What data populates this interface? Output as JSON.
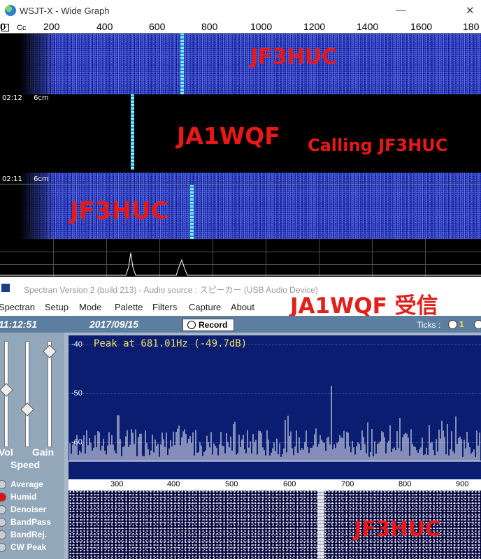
{
  "wsjt": {
    "title": "WSJT-X - Wide Graph",
    "minimize_glyph": "—",
    "close_glyph": "✕",
    "corner_label": "Cc",
    "freq_labels": [
      "0",
      "200",
      "400",
      "600",
      "800",
      "1000",
      "1200",
      "1400",
      "1600",
      "180"
    ],
    "bands": [
      {
        "time": "",
        "mode": "",
        "callsign": "JF3HUC"
      },
      {
        "time": "02:12",
        "mode": "6cm",
        "callsign": "JA1WQF",
        "message": "Calling JF3HUC"
      },
      {
        "time": "02:11",
        "mode": "6cm",
        "callsign": "JF3HUC"
      }
    ],
    "colors": {
      "callsign": "#e81818",
      "trace": "#6ee8ff",
      "noise": "#141a9a"
    }
  },
  "spectran": {
    "title": "Spectran Version 2  (build 213) - Audio source  : スピーカー (USB Audio Device)",
    "menu": [
      "Spectran",
      "Setup",
      "Mode",
      "Palette",
      "Filters",
      "Capture",
      "About"
    ],
    "overlay_text": "JA1WQF 受信",
    "time": "11:12:51",
    "date": "2017/09/15",
    "record_label": "Record",
    "ticks_label": "Ticks :",
    "ticks_value": "1",
    "sliders": {
      "vol_label": "Vol",
      "gain_label": "Gain",
      "speed_label": "Speed"
    },
    "options": [
      {
        "label": "Average",
        "selected": false
      },
      {
        "label": "Humid",
        "selected": true
      },
      {
        "label": "Denoiser",
        "selected": false
      },
      {
        "label": "BandPass",
        "selected": false
      },
      {
        "label": "BandRej.",
        "selected": false
      },
      {
        "label": "CW Peak",
        "selected": false
      }
    ],
    "peak_text": "Peak at  681.01Hz (-49.7dB)",
    "y_labels": [
      "-40",
      "-50",
      "-60"
    ],
    "x_labels": [
      "300",
      "400",
      "500",
      "600",
      "700",
      "800",
      "900"
    ],
    "waterfall_callsign": "JF3HUC",
    "colors": {
      "graph_bg": "#0a1d70",
      "peak_text": "#f0e060",
      "overlay": "#e0201a"
    }
  }
}
